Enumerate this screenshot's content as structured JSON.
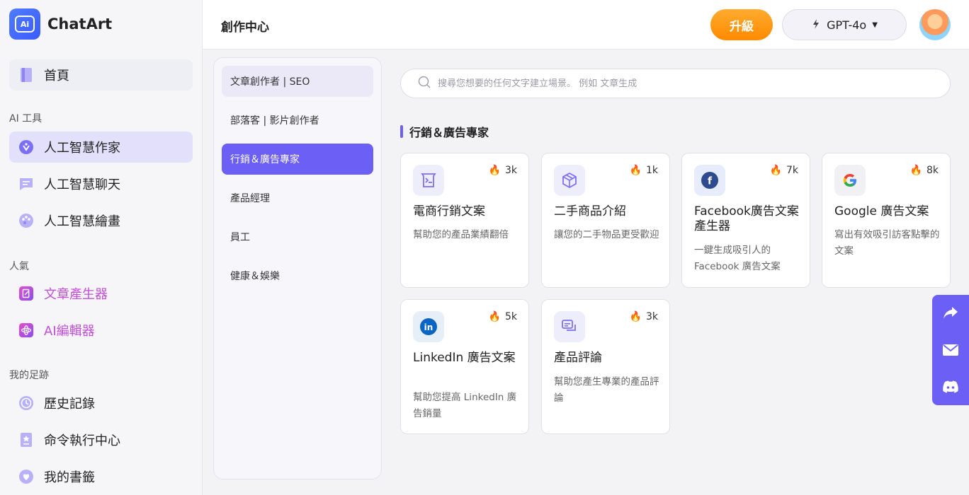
{
  "brand": {
    "name": "ChatArt",
    "logo_text": "Ai"
  },
  "sidebar": {
    "home": {
      "label": "首頁"
    },
    "ai_tools_label": "AI 工具",
    "ai_tools": [
      {
        "label": "人工智慧作家",
        "icon": "ai-writer-icon",
        "active": true
      },
      {
        "label": "人工智慧聊天",
        "icon": "chat-icon"
      },
      {
        "label": "人工智慧繪畫",
        "icon": "palette-icon"
      }
    ],
    "popular_label": "人氣",
    "popular": [
      {
        "label": "文章產生器",
        "icon": "article-generator-icon",
        "color": "#c24fd8"
      },
      {
        "label": "AI編輯器",
        "icon": "ai-editor-icon",
        "color": "#c24fd8"
      }
    ],
    "footprint_label": "我的足跡",
    "footprint": [
      {
        "label": "歷史記錄",
        "icon": "history-icon"
      },
      {
        "label": "命令執行中心",
        "icon": "command-center-icon"
      },
      {
        "label": "我的書籤",
        "icon": "bookmark-icon"
      }
    ]
  },
  "topbar": {
    "title": "創作中心",
    "upgrade_label": "升級",
    "model_label": "GPT-4o"
  },
  "categories": [
    {
      "label": "文章創作者 | SEO"
    },
    {
      "label": "部落客 | 影片創作者"
    },
    {
      "label": "行銷＆廣告專家",
      "selected": true
    },
    {
      "label": "產品經理"
    },
    {
      "label": "員工"
    },
    {
      "label": "健康＆娛樂"
    }
  ],
  "search": {
    "placeholder": "搜尋您想要的任何文字建立場景。 例如 文章生成"
  },
  "section": {
    "title": "行銷＆廣告專家"
  },
  "cards": [
    {
      "title": "電商行銷文案",
      "desc": "幫助您的產品業績翻倍",
      "heat": "3k",
      "icon": "ecommerce-icon"
    },
    {
      "title": "二手商品介紹",
      "desc": "讓您的二手物品更受歡迎",
      "heat": "1k",
      "icon": "box-icon"
    },
    {
      "title": "Facebook廣告文案產生器",
      "desc": "一鍵生成吸引人的 Facebook 廣告文案",
      "heat": "7k",
      "icon": "facebook-icon"
    },
    {
      "title": "Google 廣告文案",
      "desc": "寫出有效吸引訪客點擊的文案",
      "heat": "8k",
      "icon": "google-icon"
    },
    {
      "title": "LinkedIn 廣告文案",
      "desc": "幫助您提高 LinkedIn 廣告銷量",
      "heat": "5k",
      "icon": "linkedin-icon"
    },
    {
      "title": "產品評論",
      "desc": "幫助您產生專業的產品評論",
      "heat": "3k",
      "icon": "review-icon"
    }
  ],
  "colors": {
    "accent": "#6c5ff5",
    "upgrade": "#ff9a16",
    "hot": "#ff6a00"
  }
}
